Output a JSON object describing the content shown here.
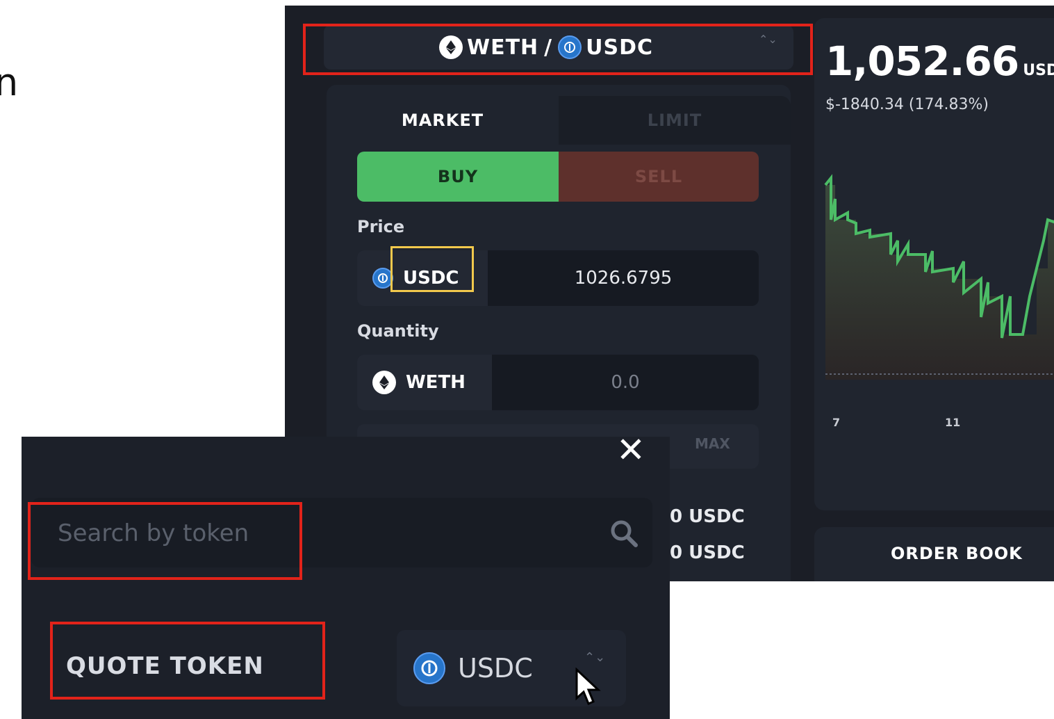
{
  "stray_glyph": "n",
  "trade_panel": {
    "pair": {
      "base": "WETH",
      "separator": "/",
      "quote": "USDC",
      "arrows": "⌃⌄"
    },
    "tabs": {
      "market": "MARKET",
      "limit": "LIMIT"
    },
    "side": {
      "buy": "BUY",
      "sell": "SELL"
    },
    "price": {
      "label": "Price",
      "token": "USDC",
      "value": "1026.6795"
    },
    "quantity": {
      "label": "Quantity",
      "token": "WETH",
      "value": "0.0"
    },
    "max_label": "MAX",
    "summary_lines": [
      "0 USDC",
      "0 USDC"
    ]
  },
  "chart": {
    "price": "1,052.66",
    "unit": "USDC",
    "change": "$-1840.34 (174.83%)",
    "x_ticks": [
      "7",
      "11"
    ],
    "colors": {
      "line": "#4cbc66",
      "fill_top": "#3b4a3c",
      "fill_bottom": "#2a2526"
    }
  },
  "order_book": {
    "label": "ORDER BOOK"
  },
  "selector": {
    "close_glyph": "✕",
    "search_placeholder": "Search by token",
    "quote_label": "QUOTE TOKEN",
    "quote_value": "USDC",
    "arrows": "⌃⌄"
  },
  "colors": {
    "annotation_red": "#e2231a",
    "annotation_yellow": "#f2c94c",
    "buy_green": "#4cbc66",
    "sell_red": "#5e302c",
    "usdc_blue": "#2775ca"
  }
}
